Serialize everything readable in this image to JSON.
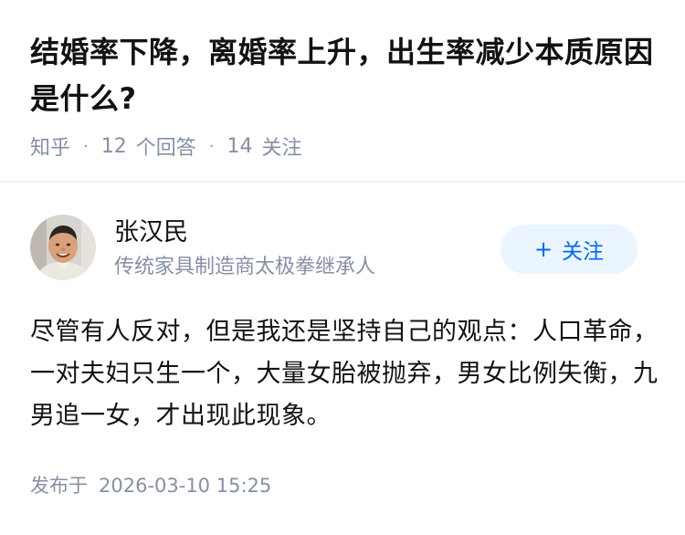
{
  "question": {
    "title": "结婚率下降，离婚率上升，出生率减少本质原因是什么?",
    "source": "知乎",
    "separator": "·",
    "answers_count": "12",
    "answers_label": "个回答",
    "followers_count": "14",
    "followers_label": "关注"
  },
  "author": {
    "name": "张汉民",
    "headline": "传统家具制造商太极拳继承人",
    "avatar_icon": "user-avatar-photo"
  },
  "follow_button": {
    "plus": "+",
    "label": "关注"
  },
  "answer": {
    "content": "尽管有人反对，但是我还是坚持自己的观点：人口革命，一对夫妇只生一个，大量女胎被抛弃，男女比例失衡，九男追一女，才出现此现象。"
  },
  "publish": {
    "label": "发布于",
    "time": "2026-03-10 15:25"
  },
  "colors": {
    "accent": "#0066ff",
    "follow_bg": "#ebf5ff",
    "meta_gray": "#8590a6",
    "divider": "#f0f2f7"
  }
}
